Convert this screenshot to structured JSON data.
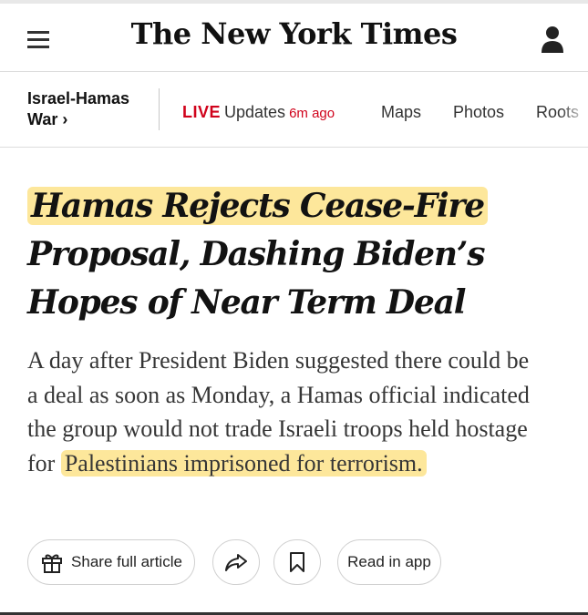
{
  "header": {
    "logo_text": "The New York Times",
    "menu_icon": "hamburger-menu-icon",
    "account_icon": "user-account-icon"
  },
  "nav": {
    "section_line1": "Israel-Hamas",
    "section_line2": "War ›",
    "live_label": "LIVE",
    "live_updates": "Updates",
    "live_ago": "6m ago",
    "items": [
      "Maps",
      "Photos",
      "Roots"
    ]
  },
  "article": {
    "headline_highlighted": "Hamas Rejects Cease-Fire",
    "headline_rest": "Proposal, Dashing Biden’s Hopes of Near Term Deal",
    "summary_text": "A day after President Biden suggested there could be a deal as soon as Monday, a Hamas official indicated the group would not trade Israeli troops held hostage for ",
    "summary_highlighted": "Palestinians imprisoned for terrorism."
  },
  "actions": {
    "share_label": "Share full article",
    "share_icon": "gift-icon",
    "forward_icon": "share-arrow-icon",
    "bookmark_icon": "bookmark-icon",
    "read_in_app_label": "Read in app"
  },
  "colors": {
    "live_red": "#d0021b",
    "highlight_yellow": "#fde79b",
    "text_dark": "#121212"
  }
}
